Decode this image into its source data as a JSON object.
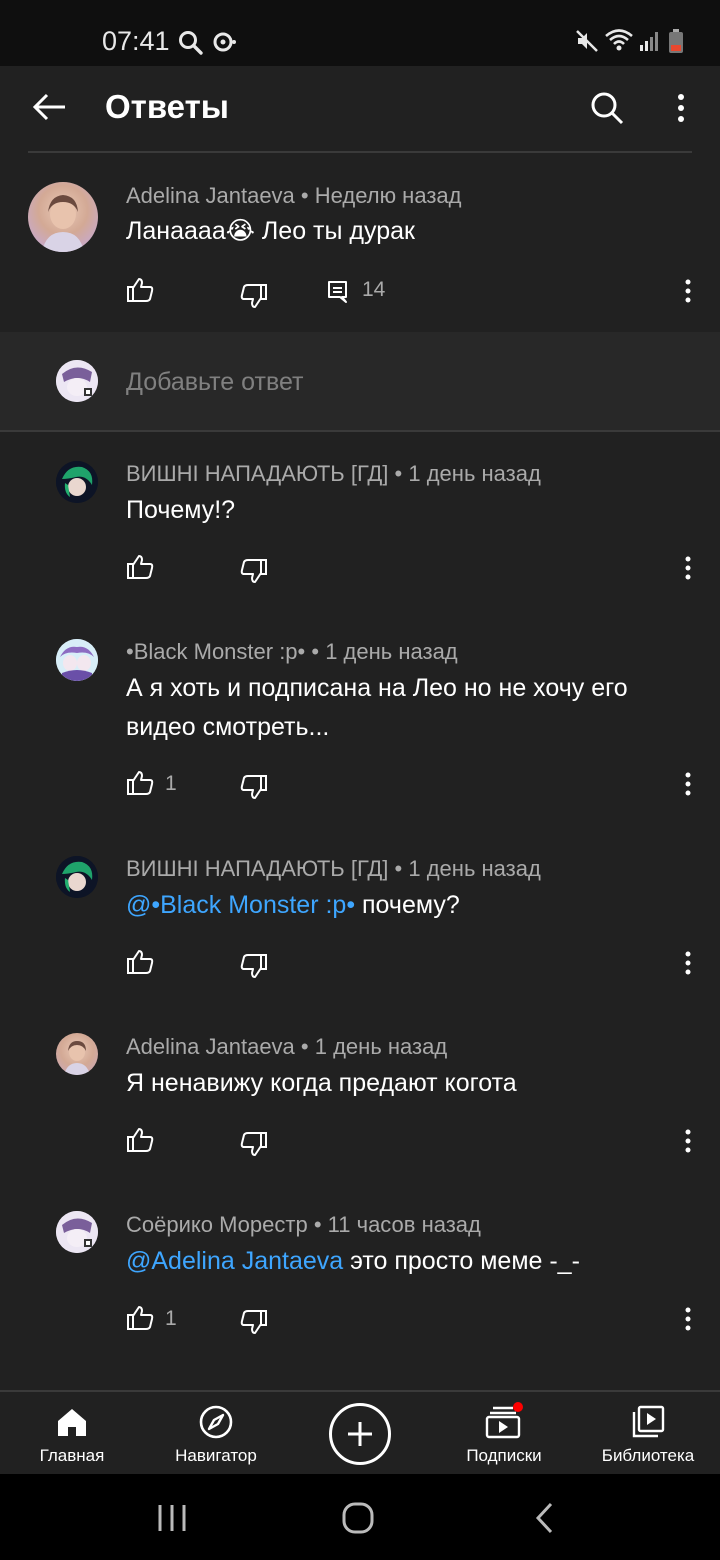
{
  "status_bar": {
    "time": "07:41",
    "left_icons": [
      "search-icon",
      "sync-icon"
    ],
    "right_icons": [
      "mute-icon",
      "wifi-icon",
      "signal-icon",
      "battery-low-icon"
    ],
    "battery_color": "#e8482f"
  },
  "header": {
    "title": "Ответы",
    "back_icon": "arrow-left-icon",
    "search_icon": "search-icon",
    "more_icon": "more-vert-icon"
  },
  "parent_comment": {
    "author": "Adelina Jantaeva",
    "time": "Неделю назад",
    "text": "Ланаааа😭 Лео ты дурак",
    "reply_count": "14"
  },
  "reply_box": {
    "placeholder": "Добавьте ответ"
  },
  "replies": [
    {
      "author": "ВИШНІ НАПАДАЮТЬ [ГД]",
      "time": "1 день назад",
      "mention": "",
      "text": "Почему!?",
      "likes": ""
    },
    {
      "author": "•Black Monster :p•",
      "time": "1 день назад",
      "mention": "",
      "text": "А я хоть и подписана на Лео но не хочу его видео смотреть...",
      "likes": "1"
    },
    {
      "author": "ВИШНІ НАПАДАЮТЬ [ГД]",
      "time": "1 день назад",
      "mention": "@•Black Monster :p•",
      "text": " почему?",
      "likes": ""
    },
    {
      "author": "Adelina Jantaeva",
      "time": "1 день назад",
      "mention": "",
      "text": "Я ненавижу когда предают когота",
      "likes": ""
    },
    {
      "author": "Соёрико Морестр",
      "time": "11 часов назад",
      "mention": "@Adelina Jantaeva",
      "text": " это просто меме -_-",
      "likes": "1"
    }
  ],
  "separator": "•",
  "bottom_nav": {
    "items": [
      {
        "label": "Главная",
        "icon": "home-icon"
      },
      {
        "label": "Навигатор",
        "icon": "compass-icon"
      },
      {
        "label": "",
        "icon": "create-plus-icon"
      },
      {
        "label": "Подписки",
        "icon": "subscriptions-icon"
      },
      {
        "label": "Библиотека",
        "icon": "library-icon"
      }
    ],
    "notification_dot_color": "#ff0000"
  },
  "system_nav": [
    "recents-icon",
    "home-circle-icon",
    "back-chevron-icon"
  ],
  "colors": {
    "background": "#212121",
    "mention": "#3ea6ff",
    "meta_text": "#aaaaaa"
  }
}
